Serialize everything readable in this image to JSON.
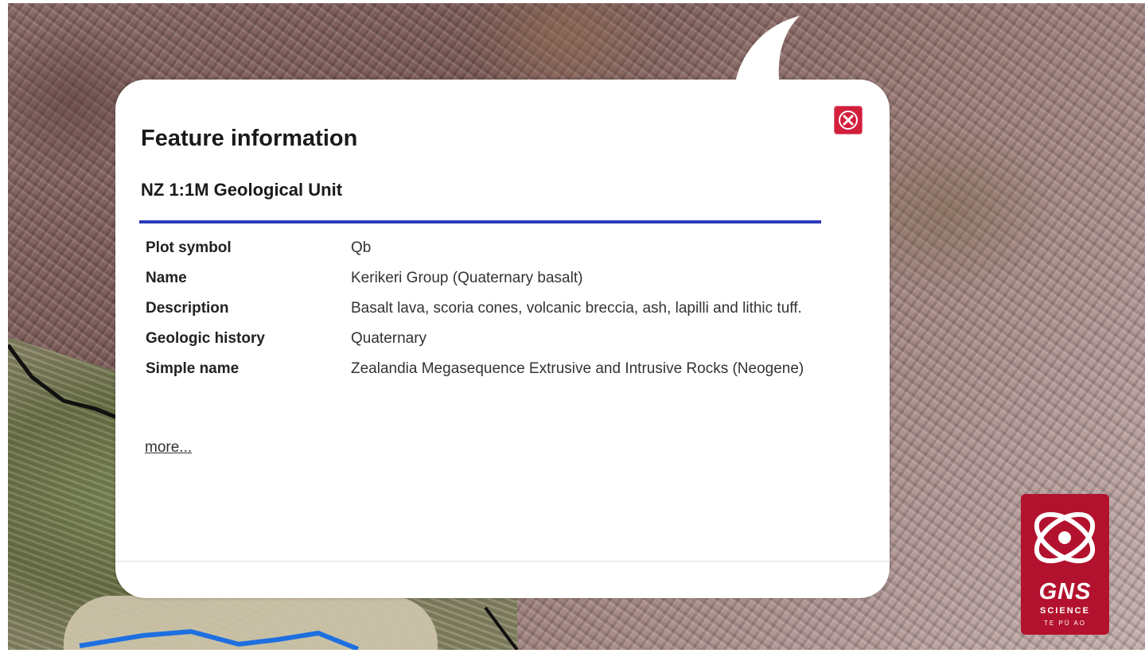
{
  "popup": {
    "title": "Feature information",
    "layer_name": "NZ 1:1M Geological Unit",
    "attributes": [
      {
        "label": "Plot symbol",
        "value": "Qb"
      },
      {
        "label": "Name",
        "value": "Kerikeri Group (Quaternary basalt)"
      },
      {
        "label": "Description",
        "value": "Basalt lava, scoria cones, volcanic breccia, ash, lapilli and lithic tuff."
      },
      {
        "label": "Geologic history",
        "value": "Quaternary"
      },
      {
        "label": "Simple name",
        "value": "Zealandia Megasequence Extrusive and Intrusive Rocks (Neogene)"
      }
    ],
    "more_link": "more...",
    "close_icon": "close-icon",
    "accent_color": "#2a3bb8",
    "close_color": "#d21f3c"
  },
  "logo": {
    "wordmark": "GNS",
    "subtitle": "SCIENCE",
    "tagline": "TE PŪ AO",
    "color": "#b3122e"
  },
  "map": {
    "boundary_color": "#1e6fe0"
  }
}
